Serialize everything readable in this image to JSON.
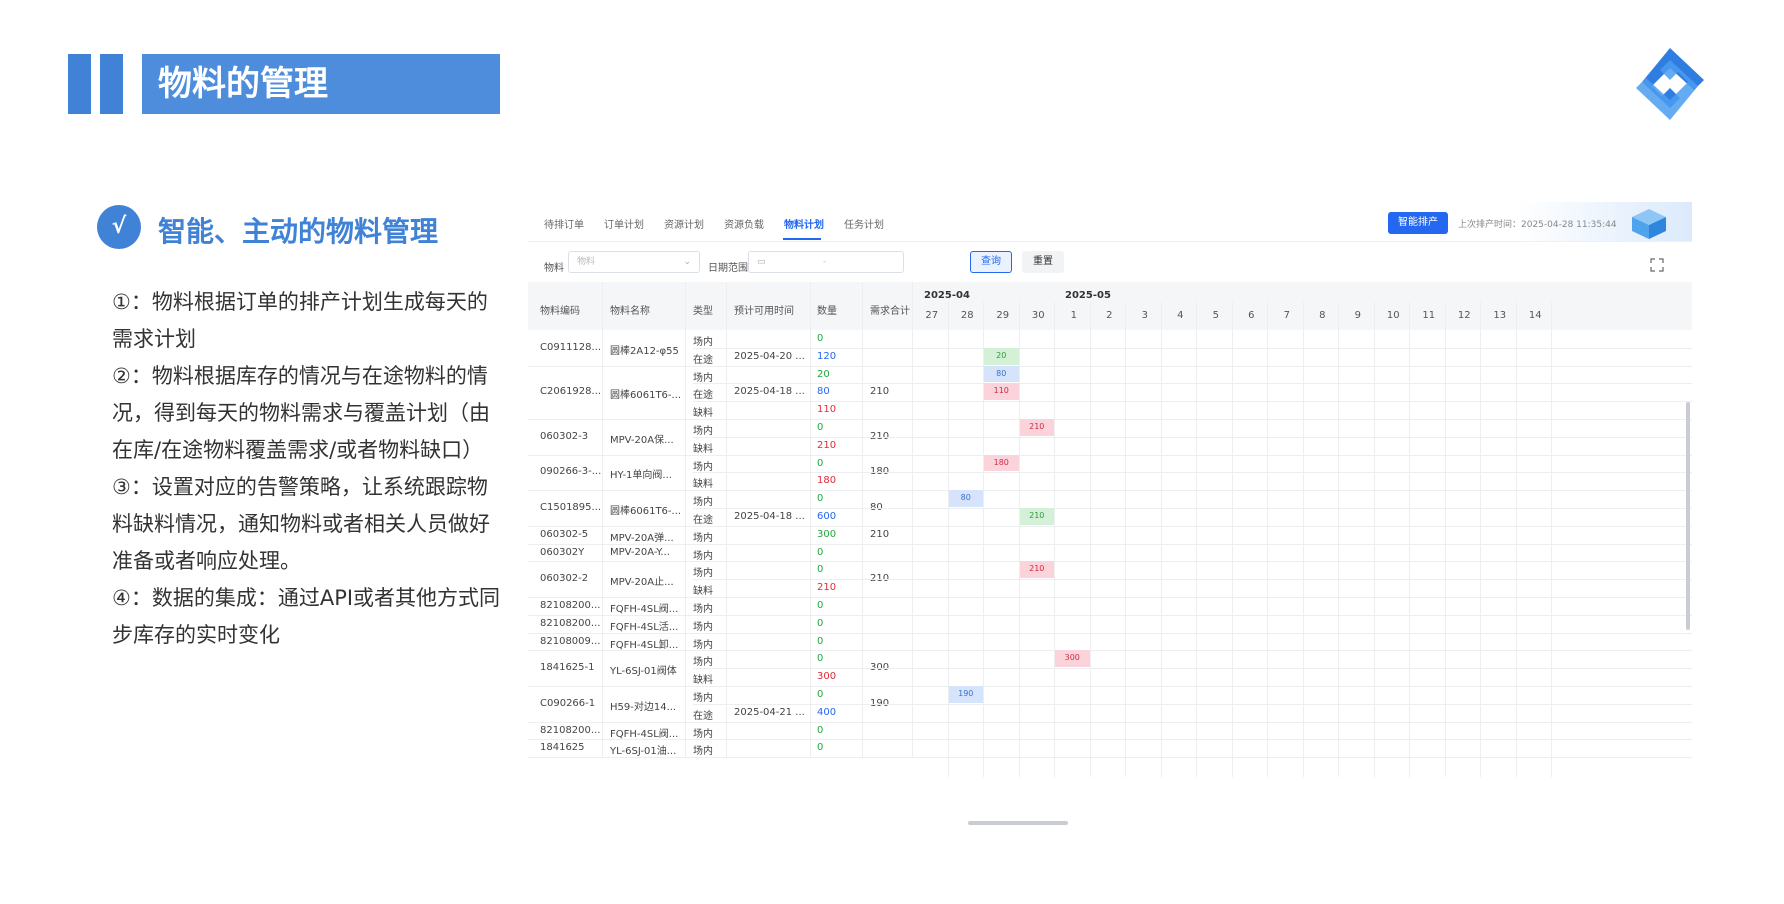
{
  "slide": {
    "title": "物料的管理",
    "check_glyph": "√",
    "subtitle": "智能、主动的物料管理",
    "bullets": [
      "①：物料根据订单的排产计划生成每天的需求计划",
      "②：物料根据库存的情况与在途物料的情况，得到每天的物料需求与覆盖计划（由在库/在途物料覆盖需求/或者物料缺口）",
      "③：设置对应的告警策略，让系统跟踪物料缺料情况，通知物料或者相关人员做好准备或者响应处理。",
      "④：数据的集成：通过API或者其他方式同步库存的实时变化"
    ]
  },
  "app": {
    "tabs": [
      "待排订单",
      "订单计划",
      "资源计划",
      "资源负载",
      "物料计划",
      "任务计划"
    ],
    "active_tab": "物料计划",
    "smart_button": "智能排产",
    "last_run": "上次排产时间：2025-04-28 11:35:44",
    "filter": {
      "material_label": "物料",
      "material_placeholder": "物料",
      "date_label": "日期范围",
      "date_separator": "-",
      "query_button": "查询",
      "reset_button": "重置"
    },
    "columns": [
      "物料编码",
      "物料名称",
      "类型",
      "预计可用时间",
      "数量",
      "需求合计"
    ],
    "months": [
      "2025-04",
      "2025-05"
    ],
    "days": [
      "27",
      "28",
      "29",
      "30",
      "1",
      "2",
      "3",
      "4",
      "5",
      "6",
      "7",
      "8",
      "9",
      "10",
      "11",
      "12",
      "13",
      "14"
    ],
    "groups": [
      {
        "code": "C0911128...",
        "name": "圆棒2A12-φ55",
        "total": "",
        "rows": [
          {
            "type": "场内",
            "time": "",
            "qty": "0",
            "color": "green"
          },
          {
            "type": "在途",
            "time": "2025-04-20 ...",
            "qty": "120",
            "color": "blue"
          }
        ]
      },
      {
        "code": "C2061928...",
        "name": "圆棒6061T6-...",
        "total": "210",
        "rows": [
          {
            "type": "场内",
            "time": "",
            "qty": "20",
            "color": "green"
          },
          {
            "type": "在途",
            "time": "2025-04-18 ...",
            "qty": "80",
            "color": "blue"
          },
          {
            "type": "缺料",
            "time": "",
            "qty": "110",
            "color": "red"
          }
        ]
      },
      {
        "code": "060302-3",
        "name": "MPV-20A保...",
        "total": "210",
        "rows": [
          {
            "type": "场内",
            "time": "",
            "qty": "0",
            "color": "green"
          },
          {
            "type": "缺料",
            "time": "",
            "qty": "210",
            "color": "red"
          }
        ]
      },
      {
        "code": "090266-3-...",
        "name": "HY-1单向阀...",
        "total": "180",
        "rows": [
          {
            "type": "场内",
            "time": "",
            "qty": "0",
            "color": "green"
          },
          {
            "type": "缺料",
            "time": "",
            "qty": "180",
            "color": "red"
          }
        ]
      },
      {
        "code": "C1501895...",
        "name": "圆棒6061T6-...",
        "total": "80",
        "rows": [
          {
            "type": "场内",
            "time": "",
            "qty": "0",
            "color": "green"
          },
          {
            "type": "在途",
            "time": "2025-04-18 ...",
            "qty": "600",
            "color": "blue"
          }
        ]
      },
      {
        "code": "060302-5",
        "name": "MPV-20A弹...",
        "total": "210",
        "rows": [
          {
            "type": "场内",
            "time": "",
            "qty": "300",
            "color": "green"
          }
        ]
      },
      {
        "code": "060302Y",
        "name": "MPV-20A-Y...",
        "total": "",
        "rows": [
          {
            "type": "场内",
            "time": "",
            "qty": "0",
            "color": "green"
          }
        ]
      },
      {
        "code": "060302-2",
        "name": "MPV-20A止...",
        "total": "210",
        "rows": [
          {
            "type": "场内",
            "time": "",
            "qty": "0",
            "color": "green"
          },
          {
            "type": "缺料",
            "time": "",
            "qty": "210",
            "color": "red"
          }
        ]
      },
      {
        "code": "82108200...",
        "name": "FQFH-4SL阀...",
        "total": "",
        "rows": [
          {
            "type": "场内",
            "time": "",
            "qty": "0",
            "color": "green"
          }
        ]
      },
      {
        "code": "82108200...",
        "name": "FQFH-4SL活...",
        "total": "",
        "rows": [
          {
            "type": "场内",
            "time": "",
            "qty": "0",
            "color": "green"
          }
        ]
      },
      {
        "code": "82108009...",
        "name": "FQFH-4SL卸...",
        "total": "",
        "rows": [
          {
            "type": "场内",
            "time": "",
            "qty": "0",
            "color": "green"
          }
        ]
      },
      {
        "code": "1841625-1",
        "name": "YL-6SJ-01阀体",
        "total": "300",
        "rows": [
          {
            "type": "场内",
            "time": "",
            "qty": "0",
            "color": "green"
          },
          {
            "type": "缺料",
            "time": "",
            "qty": "300",
            "color": "red"
          }
        ]
      },
      {
        "code": "C090266-1",
        "name": "H59-对边14...",
        "total": "190",
        "rows": [
          {
            "type": "场内",
            "time": "",
            "qty": "0",
            "color": "green"
          },
          {
            "type": "在途",
            "time": "2025-04-21 ...",
            "qty": "400",
            "color": "blue"
          }
        ]
      },
      {
        "code": "82108200...",
        "name": "FQFH-4SL阀...",
        "total": "",
        "rows": [
          {
            "type": "场内",
            "time": "",
            "qty": "0",
            "color": "green"
          }
        ]
      },
      {
        "code": "1841625",
        "name": "YL-6SJ-01油...",
        "total": "",
        "rows": [
          {
            "type": "场内",
            "time": "",
            "qty": "0",
            "color": "green"
          }
        ]
      }
    ],
    "gantt_cells": [
      {
        "row": 2,
        "day": "29",
        "value": "20",
        "color": "green"
      },
      {
        "row": 3,
        "day": "29",
        "value": "80",
        "color": "blue"
      },
      {
        "row": 4,
        "day": "29",
        "value": "110",
        "color": "red"
      },
      {
        "row": 6,
        "day": "30",
        "value": "210",
        "color": "red"
      },
      {
        "row": 8,
        "day": "29",
        "value": "180",
        "color": "red"
      },
      {
        "row": 10,
        "day": "28",
        "value": "80",
        "color": "blue"
      },
      {
        "row": 11,
        "day": "30",
        "value": "210",
        "color": "green"
      },
      {
        "row": 14,
        "day": "30",
        "value": "210",
        "color": "red"
      },
      {
        "row": 19,
        "day": "1",
        "value": "300",
        "color": "red"
      },
      {
        "row": 21,
        "day": "28",
        "value": "190",
        "color": "blue"
      }
    ]
  },
  "colors": {
    "brand": "#3f82d6",
    "primary": "#2468f2",
    "green": "#22a83b",
    "blue": "#2468f2",
    "red": "#e02c3a"
  }
}
